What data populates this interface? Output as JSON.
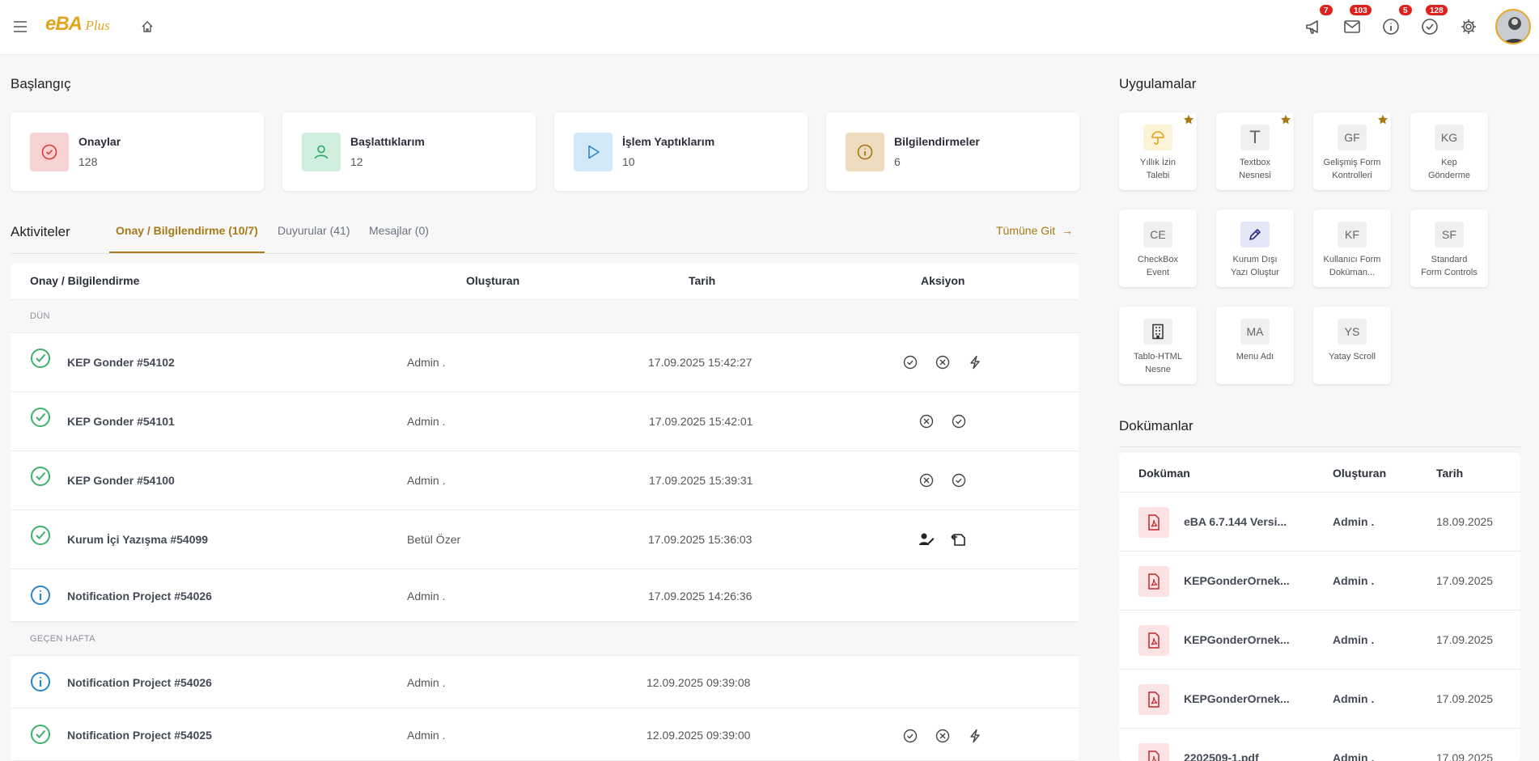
{
  "header": {
    "logo_main": "eBA",
    "logo_sub": "Plus",
    "badges": {
      "announcements": "7",
      "messages": "103",
      "info": "5",
      "approvals": "128"
    }
  },
  "start": {
    "title": "Başlangıç",
    "cards": [
      {
        "label": "Onaylar",
        "value": "128",
        "color": "#f8d3d3",
        "icon": "check-circle-icon"
      },
      {
        "label": "Başlattıklarım",
        "value": "12",
        "color": "#cfeedd",
        "icon": "user-icon"
      },
      {
        "label": "İşlem Yaptıklarım",
        "value": "10",
        "color": "#d3e9f7",
        "icon": "play-icon"
      },
      {
        "label": "Bilgilendirmeler",
        "value": "6",
        "color": "#ecdcbd",
        "icon": "info-icon"
      }
    ]
  },
  "activities": {
    "title": "Aktiviteler",
    "tabs": [
      "Onay / Bilgilendirme (10/7)",
      "Duyurular (41)",
      "Mesajlar (0)"
    ],
    "goto": "Tümüne Git",
    "columns": [
      "Onay / Bilgilendirme",
      "Oluşturan",
      "Tarih",
      "Aksiyon"
    ],
    "groups": [
      "DÜN",
      "GEÇEN HAFTA"
    ],
    "rows": [
      {
        "name": "KEP Gonder #54102",
        "creator": "Admin .",
        "date": "17.09.2025 15:42:27",
        "status": "approval"
      },
      {
        "name": "KEP Gonder #54101",
        "creator": "Admin .",
        "date": "17.09.2025 15:42:01",
        "status": "approval"
      },
      {
        "name": "KEP Gonder #54100",
        "creator": "Admin .",
        "date": "17.09.2025 15:39:31",
        "status": "approval"
      },
      {
        "name": "Kurum İçi Yazışma #54099",
        "creator": "Betül Özer",
        "date": "17.09.2025 15:36:03",
        "status": "approval"
      },
      {
        "name": "Notification Project #54026",
        "creator": "Admin .",
        "date": "17.09.2025 14:26:36",
        "status": "info"
      },
      {
        "name": "Notification Project #54026",
        "creator": "Admin .",
        "date": "12.09.2025 09:39:08",
        "status": "info"
      },
      {
        "name": "Notification Project #54025",
        "creator": "Admin .",
        "date": "12.09.2025 09:39:00",
        "status": "approval"
      }
    ]
  },
  "apps": {
    "title": "Uygulamalar",
    "items": [
      {
        "abbr": "",
        "label1": "Yıllık İzin",
        "label2": "Talebi",
        "icon": "umbrella-icon",
        "fav": true
      },
      {
        "abbr": "T",
        "label1": "Textbox",
        "label2": "Nesnesi",
        "fav": true
      },
      {
        "abbr": "GF",
        "label1": "Gelişmiş Form",
        "label2": "Kontrolleri",
        "fav": true
      },
      {
        "abbr": "KG",
        "label1": "Kep",
        "label2": "Gönderme",
        "fav": false
      },
      {
        "abbr": "CE",
        "label1": "CheckBox",
        "label2": "Event",
        "fav": false
      },
      {
        "abbr": "",
        "label1": "Kurum Dışı",
        "label2": "Yazı Oluştur",
        "icon": "pencil-icon",
        "fav": false
      },
      {
        "abbr": "KF",
        "label1": "Kullanıcı Form",
        "label2": "Doküman...",
        "fav": false
      },
      {
        "abbr": "SF",
        "label1": "Standard",
        "label2": "Form Controls",
        "fav": false
      },
      {
        "abbr": "",
        "label1": "Tablo-HTML",
        "label2": "Nesne",
        "icon": "building-icon",
        "fav": false
      },
      {
        "abbr": "MA",
        "label1": "Menu Adı",
        "label2": "",
        "fav": false
      },
      {
        "abbr": "YS",
        "label1": "Yatay Scroll",
        "label2": "",
        "fav": false
      }
    ]
  },
  "documents": {
    "title": "Dokümanlar",
    "columns": [
      "Doküman",
      "Oluşturan",
      "Tarih"
    ],
    "rows": [
      {
        "name": "eBA 6.7.144 Versi...",
        "creator": "Admin .",
        "date": "18.09.2025"
      },
      {
        "name": "KEPGonderOrnek...",
        "creator": "Admin .",
        "date": "17.09.2025"
      },
      {
        "name": "KEPGonderOrnek...",
        "creator": "Admin .",
        "date": "17.09.2025"
      },
      {
        "name": "KEPGonderOrnek...",
        "creator": "Admin .",
        "date": "17.09.2025"
      },
      {
        "name": "2202509-1.pdf",
        "creator": "Admin .",
        "date": "17.09.2025"
      }
    ]
  },
  "colors": {
    "accent": "#a57a17",
    "green": "#3fb06b",
    "blue": "#2a86c9",
    "badge": "#e0201c"
  }
}
